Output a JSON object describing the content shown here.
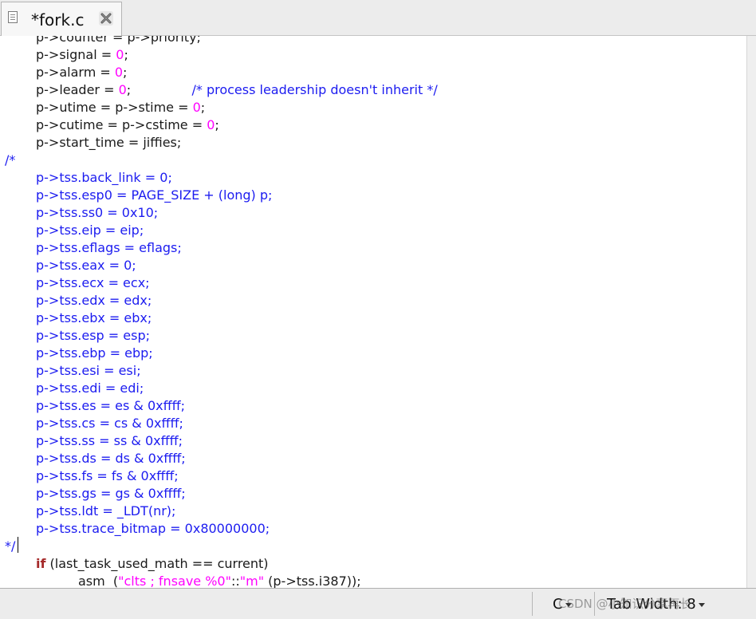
{
  "tab": {
    "title": "*fork.c",
    "close_icon": "close-icon",
    "file_icon": "text-file-icon"
  },
  "editor": {
    "lines": [
      {
        "kind": "code",
        "indent": 1,
        "tokens": [
          [
            "t",
            "p->counter = p->priority;"
          ]
        ]
      },
      {
        "kind": "code",
        "indent": 1,
        "tokens": [
          [
            "t",
            "p->signal = "
          ],
          [
            "n",
            "0"
          ],
          [
            "t",
            ";"
          ]
        ]
      },
      {
        "kind": "code",
        "indent": 1,
        "tokens": [
          [
            "t",
            "p->alarm = "
          ],
          [
            "n",
            "0"
          ],
          [
            "t",
            ";"
          ]
        ]
      },
      {
        "kind": "code",
        "indent": 1,
        "tokens": [
          [
            "t",
            "p->leader = "
          ],
          [
            "n",
            "0"
          ],
          [
            "t",
            ";"
          ],
          [
            "c",
            "               /* process leadership doesn't inherit */"
          ]
        ]
      },
      {
        "kind": "code",
        "indent": 1,
        "tokens": [
          [
            "t",
            "p->utime = p->stime = "
          ],
          [
            "n",
            "0"
          ],
          [
            "t",
            ";"
          ]
        ]
      },
      {
        "kind": "code",
        "indent": 1,
        "tokens": [
          [
            "t",
            "p->cutime = p->cstime = "
          ],
          [
            "n",
            "0"
          ],
          [
            "t",
            ";"
          ]
        ]
      },
      {
        "kind": "code",
        "indent": 1,
        "tokens": [
          [
            "t",
            "p->start_time = jiffies;"
          ]
        ]
      },
      {
        "kind": "comment",
        "indent": 0,
        "tokens": [
          [
            "t",
            "/*"
          ]
        ]
      },
      {
        "kind": "comment",
        "indent": 1,
        "tokens": [
          [
            "t",
            "p->tss.back_link = 0;"
          ]
        ]
      },
      {
        "kind": "comment",
        "indent": 1,
        "tokens": [
          [
            "t",
            "p->tss.esp0 = PAGE_SIZE + (long) p;"
          ]
        ]
      },
      {
        "kind": "comment",
        "indent": 1,
        "tokens": [
          [
            "t",
            "p->tss.ss0 = 0x10;"
          ]
        ]
      },
      {
        "kind": "comment",
        "indent": 1,
        "tokens": [
          [
            "t",
            "p->tss.eip = eip;"
          ]
        ]
      },
      {
        "kind": "comment",
        "indent": 1,
        "tokens": [
          [
            "t",
            "p->tss.eflags = eflags;"
          ]
        ]
      },
      {
        "kind": "comment",
        "indent": 1,
        "tokens": [
          [
            "t",
            "p->tss.eax = 0;"
          ]
        ]
      },
      {
        "kind": "comment",
        "indent": 1,
        "tokens": [
          [
            "t",
            "p->tss.ecx = ecx;"
          ]
        ]
      },
      {
        "kind": "comment",
        "indent": 1,
        "tokens": [
          [
            "t",
            "p->tss.edx = edx;"
          ]
        ]
      },
      {
        "kind": "comment",
        "indent": 1,
        "tokens": [
          [
            "t",
            "p->tss.ebx = ebx;"
          ]
        ]
      },
      {
        "kind": "comment",
        "indent": 1,
        "tokens": [
          [
            "t",
            "p->tss.esp = esp;"
          ]
        ]
      },
      {
        "kind": "comment",
        "indent": 1,
        "tokens": [
          [
            "t",
            "p->tss.ebp = ebp;"
          ]
        ]
      },
      {
        "kind": "comment",
        "indent": 1,
        "tokens": [
          [
            "t",
            "p->tss.esi = esi;"
          ]
        ]
      },
      {
        "kind": "comment",
        "indent": 1,
        "tokens": [
          [
            "t",
            "p->tss.edi = edi;"
          ]
        ]
      },
      {
        "kind": "comment",
        "indent": 1,
        "tokens": [
          [
            "t",
            "p->tss.es = es & 0xffff;"
          ]
        ]
      },
      {
        "kind": "comment",
        "indent": 1,
        "tokens": [
          [
            "t",
            "p->tss.cs = cs & 0xffff;"
          ]
        ]
      },
      {
        "kind": "comment",
        "indent": 1,
        "tokens": [
          [
            "t",
            "p->tss.ss = ss & 0xffff;"
          ]
        ]
      },
      {
        "kind": "comment",
        "indent": 1,
        "tokens": [
          [
            "t",
            "p->tss.ds = ds & 0xffff;"
          ]
        ]
      },
      {
        "kind": "comment",
        "indent": 1,
        "tokens": [
          [
            "t",
            "p->tss.fs = fs & 0xffff;"
          ]
        ]
      },
      {
        "kind": "comment",
        "indent": 1,
        "tokens": [
          [
            "t",
            "p->tss.gs = gs & 0xffff;"
          ]
        ]
      },
      {
        "kind": "comment",
        "indent": 1,
        "tokens": [
          [
            "t",
            "p->tss.ldt = _LDT(nr);"
          ]
        ]
      },
      {
        "kind": "comment",
        "indent": 1,
        "tokens": [
          [
            "t",
            "p->tss.trace_bitmap = 0x80000000;"
          ]
        ]
      },
      {
        "kind": "comment",
        "indent": 0,
        "tokens": [
          [
            "t",
            "*/"
          ]
        ]
      },
      {
        "kind": "code",
        "indent": 1,
        "tokens": [
          [
            "k",
            "if"
          ],
          [
            "t",
            " (last_task_used_math == current)"
          ]
        ]
      },
      {
        "kind": "code",
        "indent": 2,
        "tokens": [
          [
            "t",
            "asm  ("
          ],
          [
            "s",
            "\"clts ; fnsave %0\""
          ],
          [
            "t",
            "::"
          ],
          [
            "s",
            "\"m\""
          ],
          [
            "t",
            " (p->tss.i387));"
          ]
        ]
      }
    ]
  },
  "status": {
    "language": "C",
    "tab_width": "Tab Width: 8",
    "watermark": "CSDN @小知识分享再长"
  }
}
